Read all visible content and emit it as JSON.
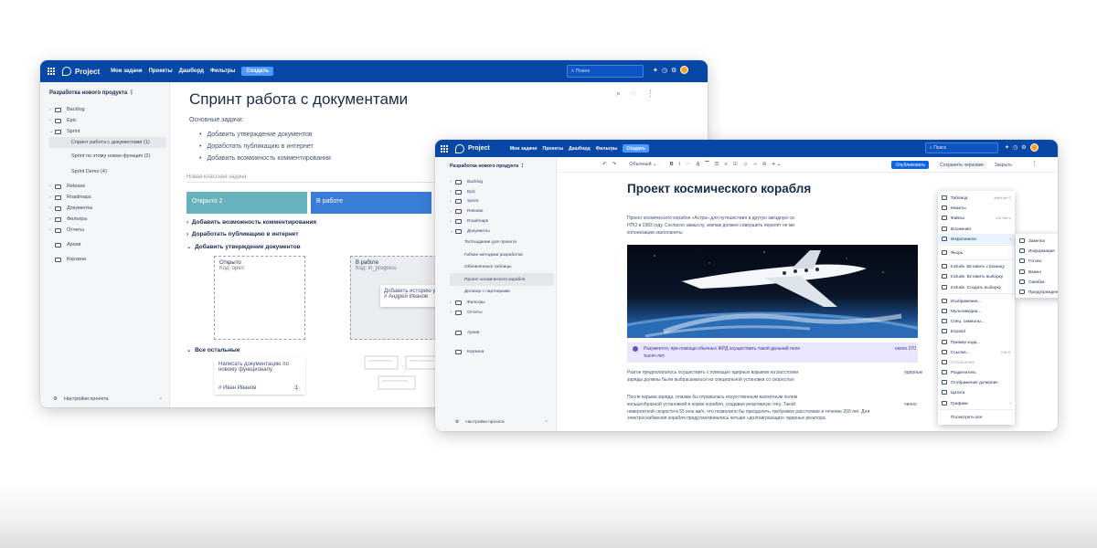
{
  "app": {
    "logo": "Project",
    "nav": [
      "Мои задачи",
      "Проекты",
      "Дашборд",
      "Фильтры"
    ],
    "create_label": "Создать",
    "search_placeholder": "Поиск"
  },
  "window1": {
    "sidebar": {
      "project_name": "Разработка нового продукта",
      "items": [
        {
          "label": "Backlog",
          "icon": "backlog-icon",
          "chev": "›"
        },
        {
          "label": "Epic",
          "icon": "epic-icon",
          "chev": "›"
        },
        {
          "label": "Sprint",
          "icon": "sprint-icon",
          "chev": "⌄"
        }
      ],
      "sprint_children": [
        "Спринт работа с документами (1)",
        "Sprint по этому новая функция (2)",
        "Sprint Demo (4)"
      ],
      "items_after": [
        {
          "label": "Release",
          "icon": "release-icon",
          "chev": "›"
        },
        {
          "label": "Roadmaps",
          "icon": "roadmaps-icon",
          "chev": "›"
        },
        {
          "label": "Документы",
          "icon": "documents-icon",
          "chev": "›"
        },
        {
          "label": "Фильтры",
          "icon": "filters-icon",
          "chev": "›"
        },
        {
          "label": "Отчеты",
          "icon": "reports-icon",
          "chev": "›"
        },
        {
          "label": "Архив",
          "icon": "archive-icon",
          "chev": ""
        },
        {
          "label": "Корзина",
          "icon": "trash-icon",
          "chev": ""
        }
      ],
      "settings_label": "Настройки проекта"
    },
    "main": {
      "title": "Спринт работа с документами",
      "subheading": "Основные задачи:",
      "bullets": [
        "Добавить утверждение документов",
        "Доработать публикацию в интернет",
        "Добавить возможность комментирования"
      ],
      "new_task_placeholder": "Новая классная задача",
      "columns": [
        {
          "label": "Открыто 2",
          "color": "#68b3bb"
        },
        {
          "label": "В работе",
          "color": "#3a7dd8"
        }
      ],
      "groups": [
        "Добавить возможность комментирования",
        "Доработать публикацию в интернет",
        "Добавить утверждение документов"
      ],
      "status_open": {
        "title": "Открыто",
        "code": "Код: open"
      },
      "status_work": {
        "title": "В работе",
        "code": "Код: in_progress"
      },
      "hover_card": {
        "title": "Добавить историю утвержденией",
        "assignee": "# Андрей Иванов"
      },
      "other_group": "Все остальные",
      "task_card": {
        "title": "Написать документацию по новому функционалу",
        "assignee": "# Иван Иванов",
        "count": "1"
      }
    }
  },
  "window2": {
    "sidebar": {
      "project_name": "Разработка нового продукта",
      "items": [
        {
          "label": "Backlog",
          "icon": "backlog-icon",
          "chev": "›"
        },
        {
          "label": "Epic",
          "icon": "epic-icon",
          "chev": "›"
        },
        {
          "label": "Sprint",
          "icon": "sprint-icon",
          "chev": "›"
        },
        {
          "label": "Release",
          "icon": "release-icon",
          "chev": "›"
        },
        {
          "label": "Roadmaps",
          "icon": "roadmaps-icon",
          "chev": "›"
        },
        {
          "label": "Документы",
          "icon": "documents-icon",
          "chev": "⌄"
        }
      ],
      "doc_children": [
        "Techзадание для проекта",
        "Гибкие методики разработки",
        "Обновленные таблицы",
        "Проект космического корабля",
        "Договор с партнерами"
      ],
      "items_after": [
        {
          "label": "Фильтры",
          "icon": "filters-icon",
          "chev": "›"
        },
        {
          "label": "Отчеты",
          "icon": "reports-icon",
          "chev": "›"
        },
        {
          "label": "Архив",
          "icon": "archive-icon",
          "chev": ""
        },
        {
          "label": "Корзина",
          "icon": "trash-icon",
          "chev": ""
        }
      ],
      "settings_label": "Настройки проекта"
    },
    "toolbar": {
      "undo": "↶",
      "redo": "↷",
      "style_select": "Обычный ⌄",
      "bold": "B",
      "italic": "I",
      "more": "···",
      "publish_label": "Опубликовать",
      "save_draft_label": "Сохранить черновик",
      "close_label": "Закрыть"
    },
    "doc": {
      "title": "Проект космического корабля",
      "paragraph1": [
        "Проект космического корабля «Астра» для путешествия в другую звёздную си",
        "НПО в 1983 году. Согласно замыслу, экипаж должен совершить перелёт не ме",
        "колонизации экзопланеты"
      ],
      "info_panel": [
        "Разумеется, при помощи обычных ЖРД осуществить такой дальний поле",
        "тысяч лет."
      ],
      "info_tail": "около 270",
      "paragraph2": [
        "Разгон предполагалось осуществить с помощью ядерных взрывов на расстояни",
        "заряды должны были выбрасываться из специальной установки со скоростью"
      ],
      "paragraph2_tail": "ядерные",
      "paragraph3": [
        "После взрыва заряда, плазма бы отражалась искусственным магнитным полем",
        "кольцеобразной установкой в корме корабля, создавая реактивную тягу. Такой",
        "невероятной скорости в 55 млн км/ч, что позволило бы преодолеть требуемое расстояние в течение 200 лет. Для",
        "электроснабжения корабля предусматривались четыре «долгоиграющих» ядерных реактора."
      ],
      "paragraph3_tails": [
        "",
        "чинно"
      ]
    },
    "insert_menu": [
      {
        "label": "Таблица",
        "icon": "table-icon",
        "shortcut": "shift+alt+T"
      },
      {
        "label": "Макеты",
        "icon": "layouts-icon"
      },
      {
        "label": "Файлы",
        "icon": "files-icon",
        "shortcut": "Ctrl+alt+x"
      },
      {
        "label": "Вложения",
        "icon": "attachments-icon"
      },
      {
        "label": "Инфопанели",
        "icon": "infopanel-icon",
        "submenu": true,
        "active": true
      },
      {
        "sep": true
      },
      {
        "label": "Якорь",
        "icon": "anchor-icon"
      },
      {
        "sep": true
      },
      {
        "label": "Include. Вставить страницу",
        "icon": "include-page-icon"
      },
      {
        "label": "Include. Вставить выборку",
        "icon": "include-selection-icon"
      },
      {
        "label": "Include. Создать выборку",
        "icon": "include-create-icon"
      },
      {
        "sep": true
      },
      {
        "label": "Изображение...",
        "icon": "image-icon"
      },
      {
        "label": "Мультимедиа...",
        "icon": "multimedia-icon"
      },
      {
        "label": "Спец. символы...",
        "icon": "special-chars-icon"
      },
      {
        "label": "Expand",
        "icon": "expand-icon"
      },
      {
        "label": "Пример кода...",
        "icon": "code-icon"
      },
      {
        "label": "Ссылка...",
        "icon": "link-icon",
        "shortcut": "Ctrl+K"
      },
      {
        "label": "Оглавление",
        "icon": "toc-icon",
        "disabled": true
      },
      {
        "label": "Разделитель",
        "icon": "divider-icon"
      },
      {
        "label": "Отображение дочерних",
        "icon": "children-icon"
      },
      {
        "label": "Цитата",
        "icon": "quote-icon"
      },
      {
        "label": "Графики",
        "icon": "charts-icon",
        "submenu": true
      },
      {
        "sep": true
      },
      {
        "label": "Посмотреть все",
        "icon": ""
      }
    ],
    "info_submenu": [
      {
        "label": "Заметка",
        "icon": "note-icon"
      },
      {
        "label": "Информация",
        "icon": "info-icon"
      },
      {
        "label": "Готово",
        "icon": "check-icon"
      },
      {
        "label": "Важно",
        "icon": "important-icon"
      },
      {
        "label": "Ошибка",
        "icon": "error-icon"
      },
      {
        "label": "Предупреждение",
        "icon": "warning-icon"
      }
    ]
  }
}
